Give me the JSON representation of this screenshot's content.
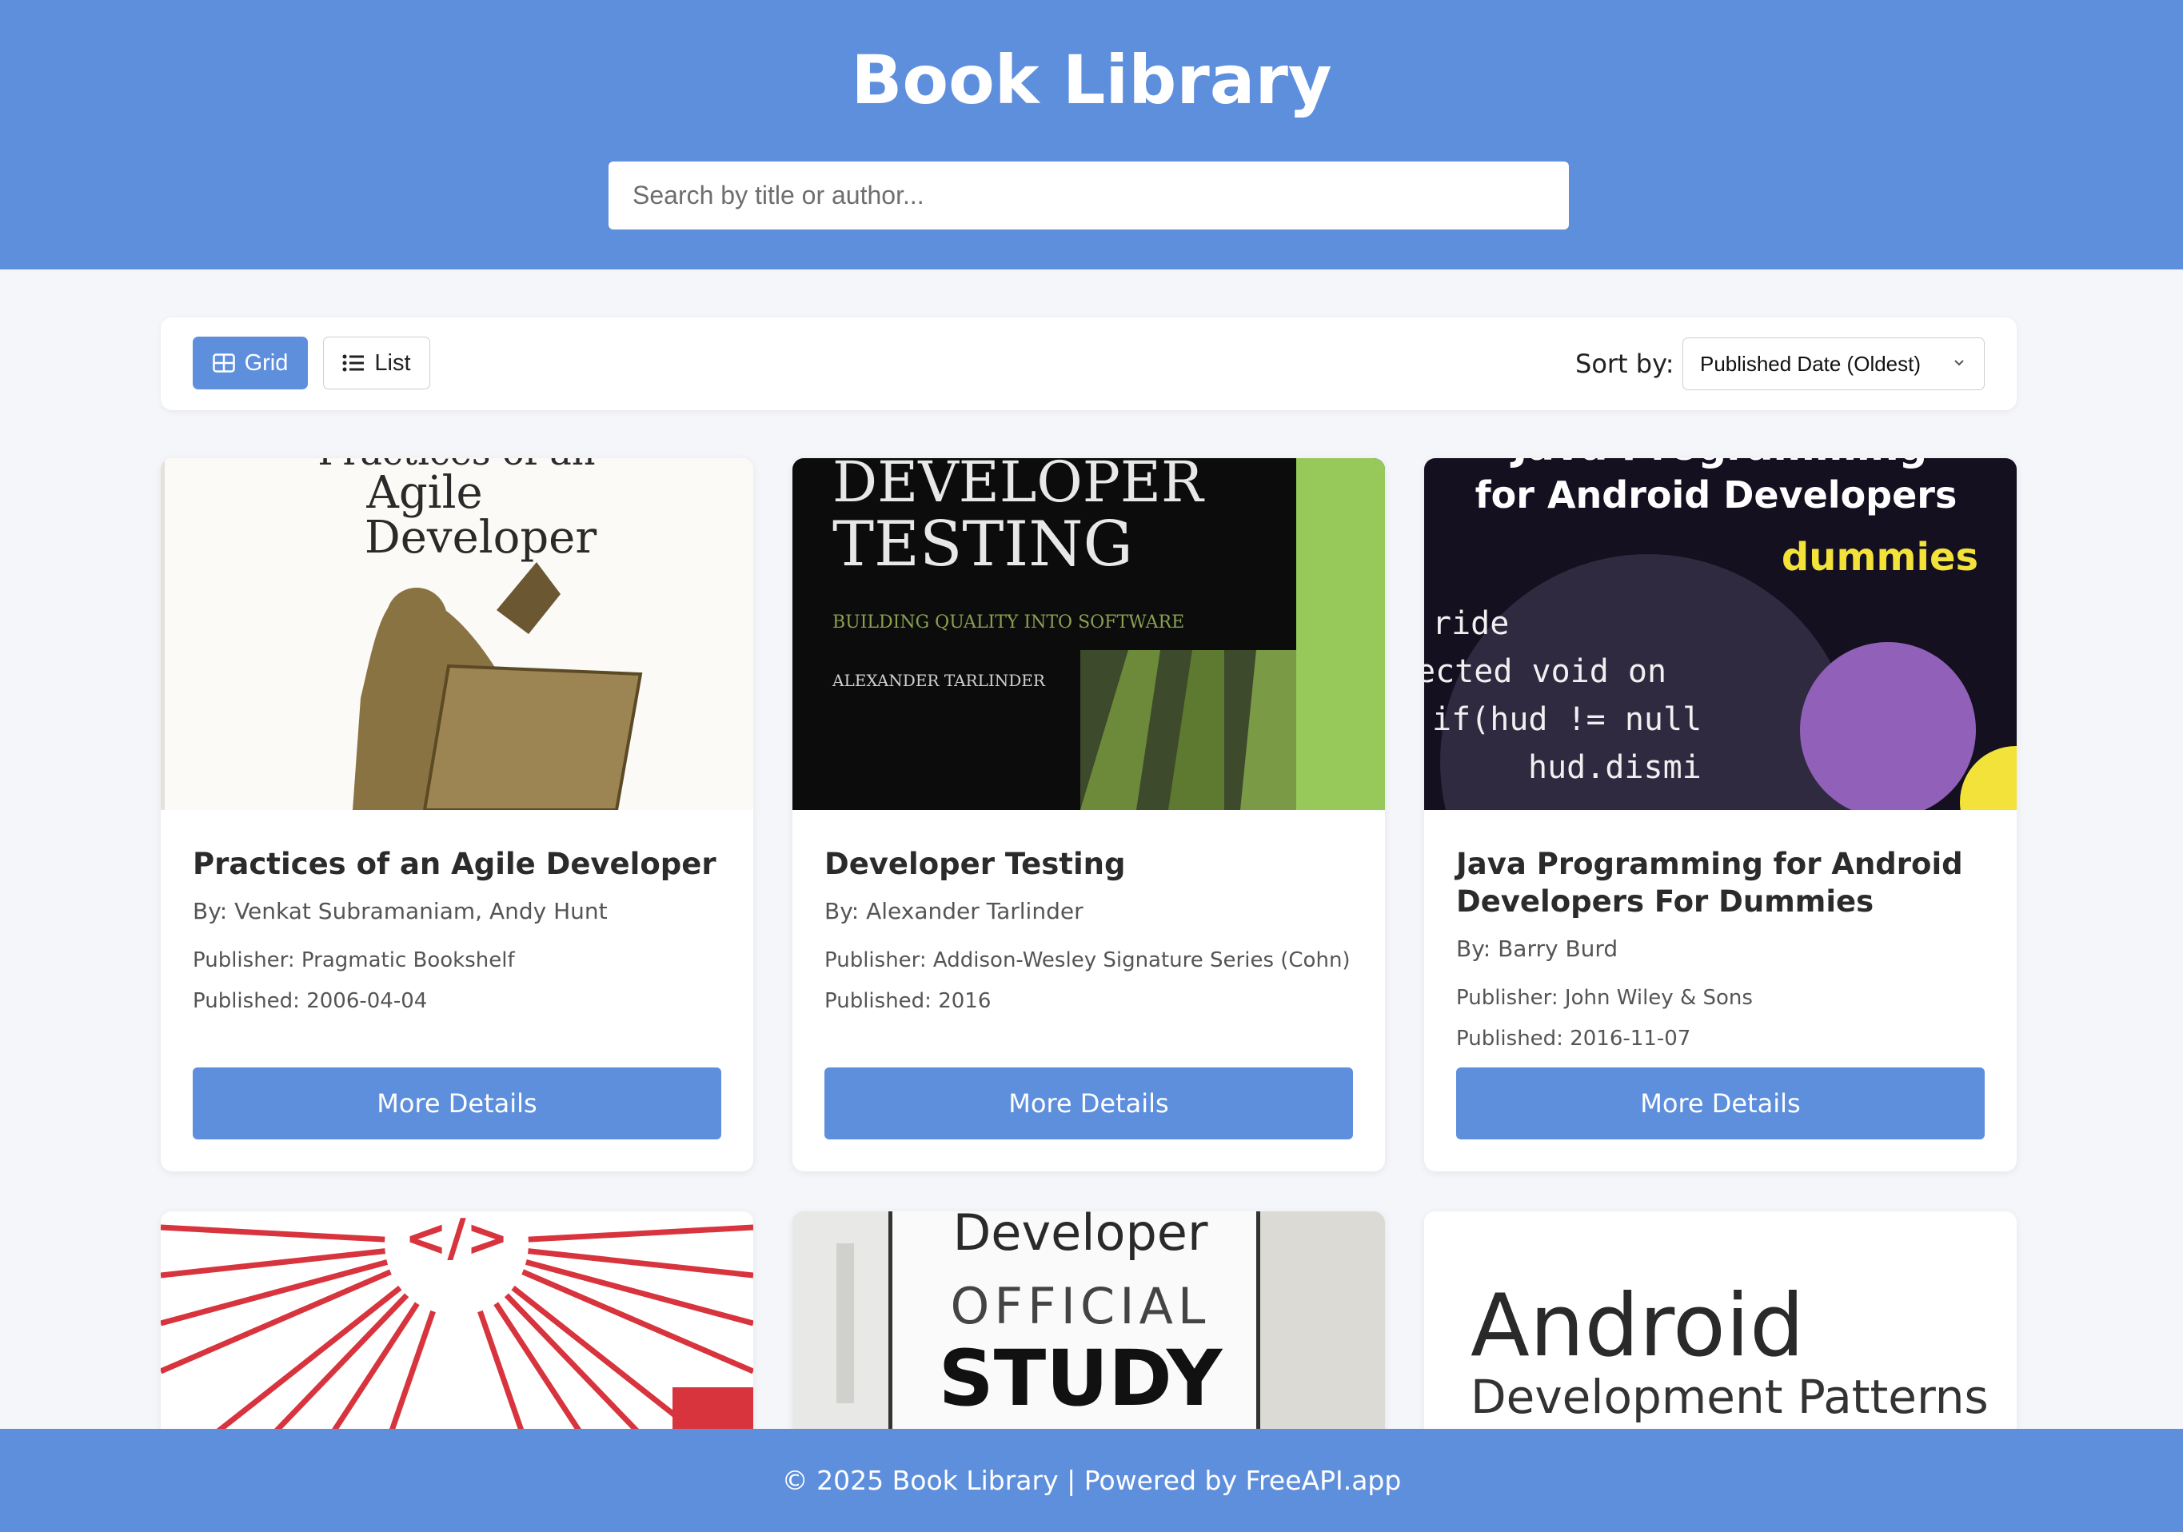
{
  "header": {
    "title": "Book Library",
    "search_placeholder": "Search by title or author..."
  },
  "toolbar": {
    "grid_label": "Grid",
    "list_label": "List",
    "sort_label": "Sort by:",
    "sort_selected": "Published Date (Oldest)",
    "active_view": "grid"
  },
  "books": [
    {
      "title": "Practices of an Agile Developer",
      "authors": "By: Venkat Subramaniam, Andy Hunt",
      "publisher": "Publisher: Pragmatic Bookshelf",
      "published": "Published: 2006-04-04",
      "button": "More Details",
      "cover_text": [
        "Practices of an",
        "Agile",
        "Developer"
      ]
    },
    {
      "title": "Developer Testing",
      "authors": "By: Alexander Tarlinder",
      "publisher": "Publisher: Addison-Wesley Signature Series (Cohn)",
      "published": "Published: 2016",
      "button": "More Details",
      "cover_text": [
        "DEVELOPER",
        "TESTING",
        "BUILDING QUALITY INTO SOFTWARE",
        "ALEXANDER TARLINDER"
      ]
    },
    {
      "title": "Java Programming for Android Developers For Dummies",
      "authors": "By: Barry Burd",
      "publisher": "Publisher: John Wiley & Sons",
      "published": "Published: 2016-11-07",
      "button": "More Details",
      "cover_text": [
        "Java Programming",
        "for Android Developers",
        "dummies",
        "ride",
        "ected void on",
        "if(hud != null",
        "hud.dismi"
      ]
    },
    {
      "cover_text": [
        "</>"
      ]
    },
    {
      "cover_text": [
        "Developer",
        "OFFICIAL",
        "STUDY"
      ]
    },
    {
      "cover_text": [
        "Android",
        "Development Patterns"
      ]
    }
  ],
  "footer": {
    "text": "© 2025 Book Library | Powered by FreeAPI.app"
  },
  "colors": {
    "primary": "#5e8fdd",
    "background": "#f5f6fa",
    "card": "#ffffff"
  }
}
